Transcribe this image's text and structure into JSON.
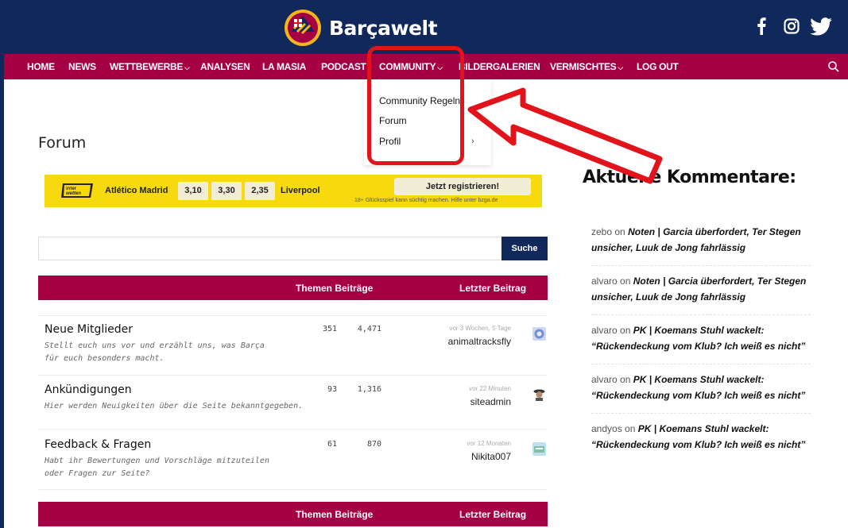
{
  "site": {
    "name": "Barçawelt",
    "colors": {
      "navy": "#10295a",
      "garnet": "#a50044",
      "highlight": "#e3131b",
      "banner_yellow": "#f6d90e"
    }
  },
  "social": [
    "facebook-icon",
    "instagram-icon",
    "twitter-icon"
  ],
  "nav": {
    "items": [
      {
        "label": "HOME",
        "dropdown": false
      },
      {
        "label": "NEWS",
        "dropdown": false
      },
      {
        "label": "WETTBEWERBE",
        "dropdown": true
      },
      {
        "label": "ANALYSEN",
        "dropdown": false
      },
      {
        "label": "LA MASIA",
        "dropdown": false
      },
      {
        "label": "PODCAST",
        "dropdown": false
      },
      {
        "label": "COMMUNITY",
        "dropdown": true
      },
      {
        "label": "BILDERGALERIEN",
        "dropdown": false
      },
      {
        "label": "VERMISCHTES",
        "dropdown": true
      },
      {
        "label": "LOG OUT",
        "dropdown": false
      }
    ],
    "dropdown_community": [
      "Community Regeln",
      "Forum",
      "Profil"
    ]
  },
  "page": {
    "title": "Forum"
  },
  "ad": {
    "brand": "inter wetten",
    "home": "Atlético Madrid",
    "odds": [
      "3,10",
      "3,30",
      "2,35"
    ],
    "away": "Liverpool",
    "cta": "Jetzt registrieren!",
    "disclaimer": "18+ Glücksspiel kann süchtig machen. Hilfe unter bzga.de"
  },
  "search": {
    "placeholder": "",
    "button": "Suche"
  },
  "forum_table": {
    "col_threads_posts": "Themen Beiträge",
    "col_last": "Letzter Beitrag",
    "rows": [
      {
        "title": "Neue Mitglieder",
        "description": "Stellt euch uns vor und erzählt uns, was Barça für euch besonders macht.",
        "topics": "351",
        "posts": "4,471",
        "last_time": "vor 3 Wochen, 5 Tage",
        "last_user": "animaltracksfly"
      },
      {
        "title": "Ankündigungen",
        "description": "Hier werden Neuigkeiten über die Seite bekanntgegeben.",
        "topics": "93",
        "posts": "1,316",
        "last_time": "vor 22 Minuten",
        "last_user": "siteadmin"
      },
      {
        "title": "Feedback & Fragen",
        "description": "Habt ihr Bewertungen und Vorschläge mitzuteilen oder Fragen zur Seite?",
        "topics": "61",
        "posts": "870",
        "last_time": "vor 12 Monaten",
        "last_user": "Nikita007"
      }
    ]
  },
  "sidebar": {
    "title": "Aktuelle Kommentare:",
    "on_word": "on",
    "comments": [
      {
        "author": "zebo",
        "post": "Noten | Garcia überfordert, Ter Stegen unsicher, Luuk de Jong fahrlässig"
      },
      {
        "author": "alvaro",
        "post": "Noten | Garcia überfordert, Ter Stegen unsicher, Luuk de Jong fahrlässig"
      },
      {
        "author": "alvaro",
        "post": "PK | Koemans Stuhl wackelt: “Rückendeckung vom Klub? Ich weiß es nicht”"
      },
      {
        "author": "alvaro",
        "post": "PK | Koemans Stuhl wackelt: “Rückendeckung vom Klub? Ich weiß es nicht”"
      },
      {
        "author": "andyos",
        "post": "PK | Koemans Stuhl wackelt: “Rückendeckung vom Klub? Ich weiß es nicht”"
      }
    ]
  }
}
